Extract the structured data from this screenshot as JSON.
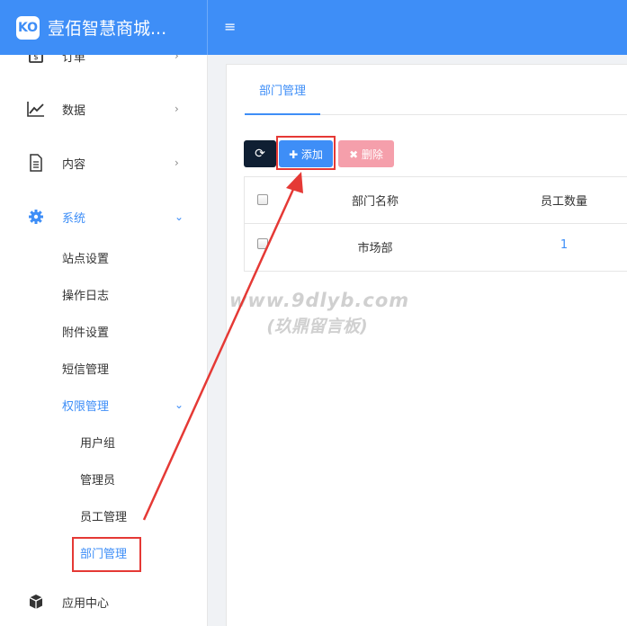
{
  "header": {
    "logo_text": "KO",
    "title": "壹佰智慧商城...",
    "menu_toggle": "≡"
  },
  "sidebar": {
    "items": [
      {
        "label": "订单",
        "arrow": "›"
      },
      {
        "label": "数据",
        "arrow": "›"
      },
      {
        "label": "内容",
        "arrow": "›"
      },
      {
        "label": "系统",
        "arrow": "⌄"
      },
      {
        "label": "应用中心"
      }
    ],
    "system_sub": [
      "站点设置",
      "操作日志",
      "附件设置",
      "短信管理"
    ],
    "permission": {
      "label": "权限管理",
      "arrow": "⌄"
    },
    "permission_sub": [
      "用户组",
      "管理员",
      "员工管理",
      "部门管理"
    ]
  },
  "main": {
    "tab": "部门管理",
    "buttons": {
      "refresh": "⟳",
      "add": "✚ 添加",
      "delete": "✖ 删除"
    },
    "table": {
      "columns": [
        "部门名称",
        "员工数量"
      ],
      "rows": [
        {
          "name": "市场部",
          "count": "1"
        }
      ]
    }
  },
  "watermark": {
    "line1": "www.9dlyb.com",
    "line2": "(玖鼎留言板)"
  },
  "colors": {
    "primary": "#3e8ef7",
    "dark_button": "#0f1f33",
    "delete_button": "#f59fab",
    "annotation_red": "#e53935"
  }
}
